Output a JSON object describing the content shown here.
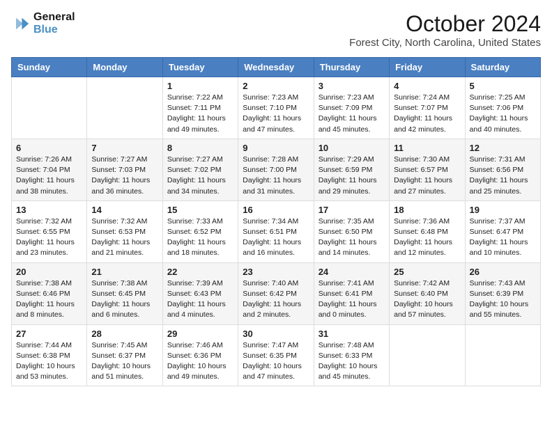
{
  "logo": {
    "line1": "General",
    "line2": "Blue",
    "icon": "▶"
  },
  "title": "October 2024",
  "location": "Forest City, North Carolina, United States",
  "weekdays": [
    "Sunday",
    "Monday",
    "Tuesday",
    "Wednesday",
    "Thursday",
    "Friday",
    "Saturday"
  ],
  "weeks": [
    [
      {
        "day": "",
        "sunrise": "",
        "sunset": "",
        "daylight": ""
      },
      {
        "day": "",
        "sunrise": "",
        "sunset": "",
        "daylight": ""
      },
      {
        "day": "1",
        "sunrise": "Sunrise: 7:22 AM",
        "sunset": "Sunset: 7:11 PM",
        "daylight": "Daylight: 11 hours and 49 minutes."
      },
      {
        "day": "2",
        "sunrise": "Sunrise: 7:23 AM",
        "sunset": "Sunset: 7:10 PM",
        "daylight": "Daylight: 11 hours and 47 minutes."
      },
      {
        "day": "3",
        "sunrise": "Sunrise: 7:23 AM",
        "sunset": "Sunset: 7:09 PM",
        "daylight": "Daylight: 11 hours and 45 minutes."
      },
      {
        "day": "4",
        "sunrise": "Sunrise: 7:24 AM",
        "sunset": "Sunset: 7:07 PM",
        "daylight": "Daylight: 11 hours and 42 minutes."
      },
      {
        "day": "5",
        "sunrise": "Sunrise: 7:25 AM",
        "sunset": "Sunset: 7:06 PM",
        "daylight": "Daylight: 11 hours and 40 minutes."
      }
    ],
    [
      {
        "day": "6",
        "sunrise": "Sunrise: 7:26 AM",
        "sunset": "Sunset: 7:04 PM",
        "daylight": "Daylight: 11 hours and 38 minutes."
      },
      {
        "day": "7",
        "sunrise": "Sunrise: 7:27 AM",
        "sunset": "Sunset: 7:03 PM",
        "daylight": "Daylight: 11 hours and 36 minutes."
      },
      {
        "day": "8",
        "sunrise": "Sunrise: 7:27 AM",
        "sunset": "Sunset: 7:02 PM",
        "daylight": "Daylight: 11 hours and 34 minutes."
      },
      {
        "day": "9",
        "sunrise": "Sunrise: 7:28 AM",
        "sunset": "Sunset: 7:00 PM",
        "daylight": "Daylight: 11 hours and 31 minutes."
      },
      {
        "day": "10",
        "sunrise": "Sunrise: 7:29 AM",
        "sunset": "Sunset: 6:59 PM",
        "daylight": "Daylight: 11 hours and 29 minutes."
      },
      {
        "day": "11",
        "sunrise": "Sunrise: 7:30 AM",
        "sunset": "Sunset: 6:57 PM",
        "daylight": "Daylight: 11 hours and 27 minutes."
      },
      {
        "day": "12",
        "sunrise": "Sunrise: 7:31 AM",
        "sunset": "Sunset: 6:56 PM",
        "daylight": "Daylight: 11 hours and 25 minutes."
      }
    ],
    [
      {
        "day": "13",
        "sunrise": "Sunrise: 7:32 AM",
        "sunset": "Sunset: 6:55 PM",
        "daylight": "Daylight: 11 hours and 23 minutes."
      },
      {
        "day": "14",
        "sunrise": "Sunrise: 7:32 AM",
        "sunset": "Sunset: 6:53 PM",
        "daylight": "Daylight: 11 hours and 21 minutes."
      },
      {
        "day": "15",
        "sunrise": "Sunrise: 7:33 AM",
        "sunset": "Sunset: 6:52 PM",
        "daylight": "Daylight: 11 hours and 18 minutes."
      },
      {
        "day": "16",
        "sunrise": "Sunrise: 7:34 AM",
        "sunset": "Sunset: 6:51 PM",
        "daylight": "Daylight: 11 hours and 16 minutes."
      },
      {
        "day": "17",
        "sunrise": "Sunrise: 7:35 AM",
        "sunset": "Sunset: 6:50 PM",
        "daylight": "Daylight: 11 hours and 14 minutes."
      },
      {
        "day": "18",
        "sunrise": "Sunrise: 7:36 AM",
        "sunset": "Sunset: 6:48 PM",
        "daylight": "Daylight: 11 hours and 12 minutes."
      },
      {
        "day": "19",
        "sunrise": "Sunrise: 7:37 AM",
        "sunset": "Sunset: 6:47 PM",
        "daylight": "Daylight: 11 hours and 10 minutes."
      }
    ],
    [
      {
        "day": "20",
        "sunrise": "Sunrise: 7:38 AM",
        "sunset": "Sunset: 6:46 PM",
        "daylight": "Daylight: 11 hours and 8 minutes."
      },
      {
        "day": "21",
        "sunrise": "Sunrise: 7:38 AM",
        "sunset": "Sunset: 6:45 PM",
        "daylight": "Daylight: 11 hours and 6 minutes."
      },
      {
        "day": "22",
        "sunrise": "Sunrise: 7:39 AM",
        "sunset": "Sunset: 6:43 PM",
        "daylight": "Daylight: 11 hours and 4 minutes."
      },
      {
        "day": "23",
        "sunrise": "Sunrise: 7:40 AM",
        "sunset": "Sunset: 6:42 PM",
        "daylight": "Daylight: 11 hours and 2 minutes."
      },
      {
        "day": "24",
        "sunrise": "Sunrise: 7:41 AM",
        "sunset": "Sunset: 6:41 PM",
        "daylight": "Daylight: 11 hours and 0 minutes."
      },
      {
        "day": "25",
        "sunrise": "Sunrise: 7:42 AM",
        "sunset": "Sunset: 6:40 PM",
        "daylight": "Daylight: 10 hours and 57 minutes."
      },
      {
        "day": "26",
        "sunrise": "Sunrise: 7:43 AM",
        "sunset": "Sunset: 6:39 PM",
        "daylight": "Daylight: 10 hours and 55 minutes."
      }
    ],
    [
      {
        "day": "27",
        "sunrise": "Sunrise: 7:44 AM",
        "sunset": "Sunset: 6:38 PM",
        "daylight": "Daylight: 10 hours and 53 minutes."
      },
      {
        "day": "28",
        "sunrise": "Sunrise: 7:45 AM",
        "sunset": "Sunset: 6:37 PM",
        "daylight": "Daylight: 10 hours and 51 minutes."
      },
      {
        "day": "29",
        "sunrise": "Sunrise: 7:46 AM",
        "sunset": "Sunset: 6:36 PM",
        "daylight": "Daylight: 10 hours and 49 minutes."
      },
      {
        "day": "30",
        "sunrise": "Sunrise: 7:47 AM",
        "sunset": "Sunset: 6:35 PM",
        "daylight": "Daylight: 10 hours and 47 minutes."
      },
      {
        "day": "31",
        "sunrise": "Sunrise: 7:48 AM",
        "sunset": "Sunset: 6:33 PM",
        "daylight": "Daylight: 10 hours and 45 minutes."
      },
      {
        "day": "",
        "sunrise": "",
        "sunset": "",
        "daylight": ""
      },
      {
        "day": "",
        "sunrise": "",
        "sunset": "",
        "daylight": ""
      }
    ]
  ]
}
